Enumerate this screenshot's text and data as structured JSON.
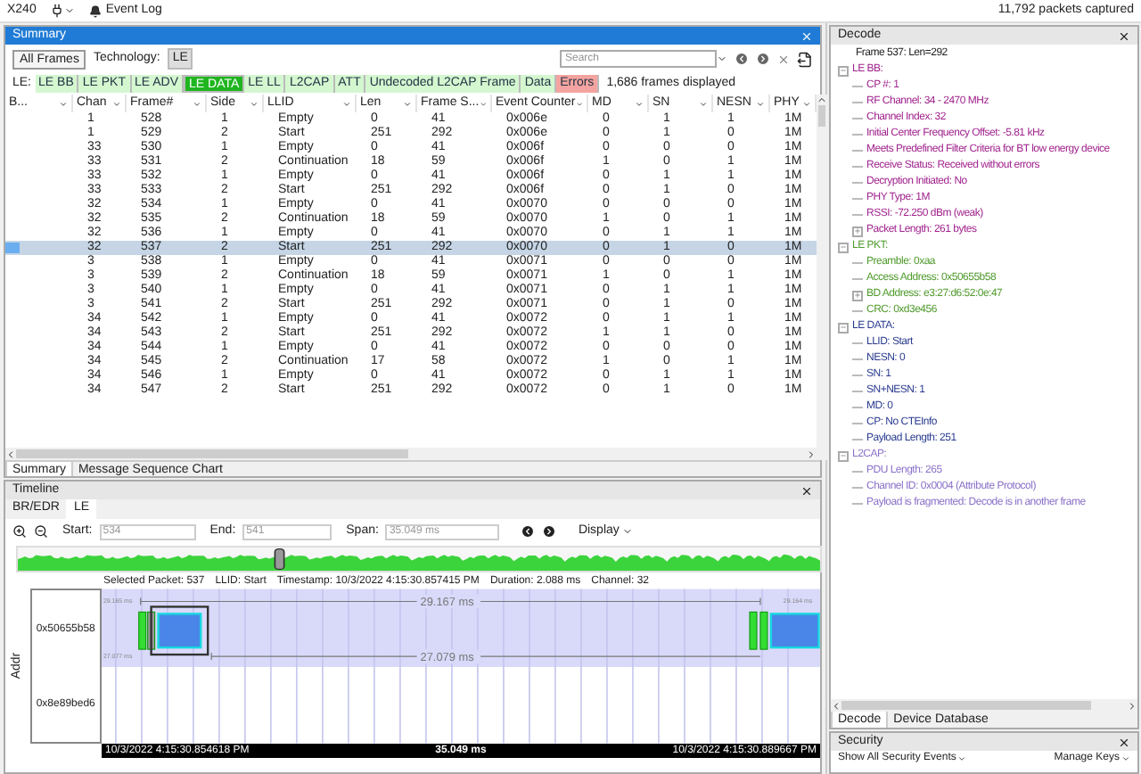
{
  "topbar": {
    "device": "X240",
    "event_log": "Event Log",
    "packets": "11,792 packets captured"
  },
  "summary": {
    "title": "Summary",
    "all_frames": "All Frames",
    "technology_label": "Technology:",
    "technology": "LE",
    "search": {
      "placeholder": "Search"
    },
    "le_label": "LE:",
    "filters": [
      {
        "label": "LE BB",
        "color": "#d4f7d0",
        "selected": false
      },
      {
        "label": "LE PKT",
        "color": "#d4f7d0",
        "selected": false
      },
      {
        "label": "LE ADV",
        "color": "#d4f7d0",
        "selected": false
      },
      {
        "label": "LE DATA",
        "color": "#1fb51f",
        "selected": true
      },
      {
        "label": "LE LL",
        "color": "#d4f7d0",
        "selected": false
      },
      {
        "label": "L2CAP",
        "color": "#d4f7d0",
        "selected": false
      },
      {
        "label": "ATT",
        "color": "#d4f7d0",
        "selected": false
      },
      {
        "label": "Undecoded L2CAP Frame",
        "color": "#d4f7d0",
        "selected": false
      },
      {
        "label": "Data",
        "color": "#d4f7d0",
        "selected": false
      },
      {
        "label": "Errors",
        "color": "#f4a4a0",
        "selected": false
      }
    ],
    "frames_displayed": "1,686 frames displayed",
    "columns": [
      "B...",
      "Chan",
      "Frame#",
      "Side",
      "LLID",
      "Len",
      "Frame S...",
      "Event Counter",
      "MD",
      "SN",
      "NESN",
      "PHY"
    ],
    "rows": [
      {
        "cells": [
          "",
          "1",
          "528",
          "1",
          "Empty",
          "0",
          "41",
          "0x006e",
          "0",
          "1",
          "1",
          "1M"
        ],
        "selected": false
      },
      {
        "cells": [
          "",
          "1",
          "529",
          "2",
          "Start",
          "251",
          "292",
          "0x006e",
          "0",
          "1",
          "0",
          "1M"
        ],
        "selected": false
      },
      {
        "cells": [
          "",
          "33",
          "530",
          "1",
          "Empty",
          "0",
          "41",
          "0x006f",
          "0",
          "0",
          "0",
          "1M"
        ],
        "selected": false
      },
      {
        "cells": [
          "",
          "33",
          "531",
          "2",
          "Continuation",
          "18",
          "59",
          "0x006f",
          "1",
          "0",
          "1",
          "1M"
        ],
        "selected": false
      },
      {
        "cells": [
          "",
          "33",
          "532",
          "1",
          "Empty",
          "0",
          "41",
          "0x006f",
          "0",
          "1",
          "1",
          "1M"
        ],
        "selected": false
      },
      {
        "cells": [
          "",
          "33",
          "533",
          "2",
          "Start",
          "251",
          "292",
          "0x006f",
          "0",
          "1",
          "0",
          "1M"
        ],
        "selected": false
      },
      {
        "cells": [
          "",
          "32",
          "534",
          "1",
          "Empty",
          "0",
          "41",
          "0x0070",
          "0",
          "0",
          "0",
          "1M"
        ],
        "selected": false
      },
      {
        "cells": [
          "",
          "32",
          "535",
          "2",
          "Continuation",
          "18",
          "59",
          "0x0070",
          "1",
          "0",
          "1",
          "1M"
        ],
        "selected": false
      },
      {
        "cells": [
          "",
          "32",
          "536",
          "1",
          "Empty",
          "0",
          "41",
          "0x0070",
          "0",
          "1",
          "1",
          "1M"
        ],
        "selected": false
      },
      {
        "cells": [
          "",
          "32",
          "537",
          "2",
          "Start",
          "251",
          "292",
          "0x0070",
          "0",
          "1",
          "0",
          "1M"
        ],
        "selected": true
      },
      {
        "cells": [
          "",
          "3",
          "538",
          "1",
          "Empty",
          "0",
          "41",
          "0x0071",
          "0",
          "0",
          "0",
          "1M"
        ],
        "selected": false
      },
      {
        "cells": [
          "",
          "3",
          "539",
          "2",
          "Continuation",
          "18",
          "59",
          "0x0071",
          "1",
          "0",
          "1",
          "1M"
        ],
        "selected": false
      },
      {
        "cells": [
          "",
          "3",
          "540",
          "1",
          "Empty",
          "0",
          "41",
          "0x0071",
          "0",
          "1",
          "1",
          "1M"
        ],
        "selected": false
      },
      {
        "cells": [
          "",
          "3",
          "541",
          "2",
          "Start",
          "251",
          "292",
          "0x0071",
          "0",
          "1",
          "0",
          "1M"
        ],
        "selected": false
      },
      {
        "cells": [
          "",
          "34",
          "542",
          "1",
          "Empty",
          "0",
          "41",
          "0x0072",
          "0",
          "1",
          "1",
          "1M"
        ],
        "selected": false
      },
      {
        "cells": [
          "",
          "34",
          "543",
          "2",
          "Start",
          "251",
          "292",
          "0x0072",
          "1",
          "1",
          "0",
          "1M"
        ],
        "selected": false
      },
      {
        "cells": [
          "",
          "34",
          "544",
          "1",
          "Empty",
          "0",
          "41",
          "0x0072",
          "0",
          "0",
          "0",
          "1M"
        ],
        "selected": false
      },
      {
        "cells": [
          "",
          "34",
          "545",
          "2",
          "Continuation",
          "17",
          "58",
          "0x0072",
          "1",
          "0",
          "1",
          "1M"
        ],
        "selected": false
      },
      {
        "cells": [
          "",
          "34",
          "546",
          "1",
          "Empty",
          "0",
          "41",
          "0x0072",
          "0",
          "1",
          "1",
          "1M"
        ],
        "selected": false
      },
      {
        "cells": [
          "",
          "34",
          "547",
          "2",
          "Start",
          "251",
          "292",
          "0x0072",
          "0",
          "1",
          "0",
          "1M"
        ],
        "selected": false
      }
    ],
    "tabs": [
      {
        "label": "Summary",
        "selected": true
      },
      {
        "label": "Message Sequence Chart",
        "selected": false
      }
    ]
  },
  "timeline": {
    "title": "Timeline",
    "tabs": [
      {
        "label": "BR/EDR",
        "selected": false
      },
      {
        "label": "LE",
        "selected": true
      }
    ],
    "start_label": "Start:",
    "start": "534",
    "end_label": "End:",
    "end": "541",
    "span_label": "Span:",
    "span": "35.049 ms",
    "display": "Display",
    "info": [
      "Selected Packet: 537",
      "LLID: Start",
      "Timestamp: 10/3/2022 4:15:30.857415 PM",
      "Duration: 2.088 ms",
      "Channel: 32"
    ],
    "axis_label": "Addr",
    "addresses": [
      "0x50655b58",
      "0x8e89bed6"
    ],
    "intervals": {
      "top": "29.167 ms",
      "bottom": "27.079 ms",
      "top_left": "29.165 ms",
      "bottom_left": "27.077 ms",
      "top_right": "29.164 ms"
    },
    "range_start": "10/3/2022 4:15:30.854618 PM",
    "range_span": "35.049 ms",
    "range_end": "10/3/2022 4:15:30.889667 PM"
  },
  "decode": {
    "title": "Decode",
    "frame": "Frame 537:  Len=292",
    "sections": [
      {
        "label": "LE BB:",
        "color": "#a1248e",
        "expanded": true,
        "children": [
          {
            "label": "CP #: 1",
            "kind": "leaf"
          },
          {
            "label": "RF Channel: 34 - 2470 MHz",
            "kind": "leaf"
          },
          {
            "label": "Channel Index: 32",
            "kind": "leaf"
          },
          {
            "label": "Initial Center Frequency Offset: -5.81  kHz",
            "kind": "leaf"
          },
          {
            "label": "Meets Predefined Filter Criteria for BT low energy device",
            "kind": "leaf"
          },
          {
            "label": "Receive Status: Received without errors",
            "kind": "leaf"
          },
          {
            "label": "Decryption Initiated: No",
            "kind": "leaf"
          },
          {
            "label": "PHY Type: 1M",
            "kind": "leaf"
          },
          {
            "label": "RSSI: -72.250 dBm (weak)",
            "kind": "leaf"
          },
          {
            "label": "Packet Length: 261  bytes",
            "kind": "node",
            "expanded": false
          }
        ]
      },
      {
        "label": "LE PKT:",
        "color": "#4f9a2c",
        "expanded": true,
        "children": [
          {
            "label": "Preamble: 0xaa",
            "kind": "leaf"
          },
          {
            "label": "Access Address: 0x50655b58",
            "kind": "leaf"
          },
          {
            "label": "BD Address: e3:27:d6:52:0e:47",
            "kind": "node",
            "expanded": false
          },
          {
            "label": "CRC: 0xd3e456",
            "kind": "leaf"
          }
        ]
      },
      {
        "label": "LE DATA:",
        "color": "#2a3b8f",
        "expanded": true,
        "children": [
          {
            "label": "LLID: Start",
            "kind": "leaf"
          },
          {
            "label": "NESN: 0",
            "kind": "leaf"
          },
          {
            "label": "SN: 1",
            "kind": "leaf"
          },
          {
            "label": "SN+NESN: 1",
            "kind": "leaf"
          },
          {
            "label": "MD: 0",
            "kind": "leaf"
          },
          {
            "label": "CP: No CTEInfo",
            "kind": "leaf"
          },
          {
            "label": "Payload Length: 251",
            "kind": "leaf"
          }
        ]
      },
      {
        "label": "L2CAP:",
        "color": "#8a70c8",
        "expanded": true,
        "children": [
          {
            "label": "PDU Length: 265",
            "kind": "leaf"
          },
          {
            "label": "Channel ID: 0x0004  (Attribute Protocol)",
            "kind": "leaf"
          },
          {
            "label": "Payload is fragmented: Decode is in another frame",
            "kind": "leaf"
          }
        ]
      }
    ],
    "tabs": [
      {
        "label": "Decode",
        "selected": true
      },
      {
        "label": "Device Database",
        "selected": false
      }
    ]
  },
  "security": {
    "title": "Security",
    "events": "Show All Security Events",
    "manage": "Manage Keys"
  }
}
